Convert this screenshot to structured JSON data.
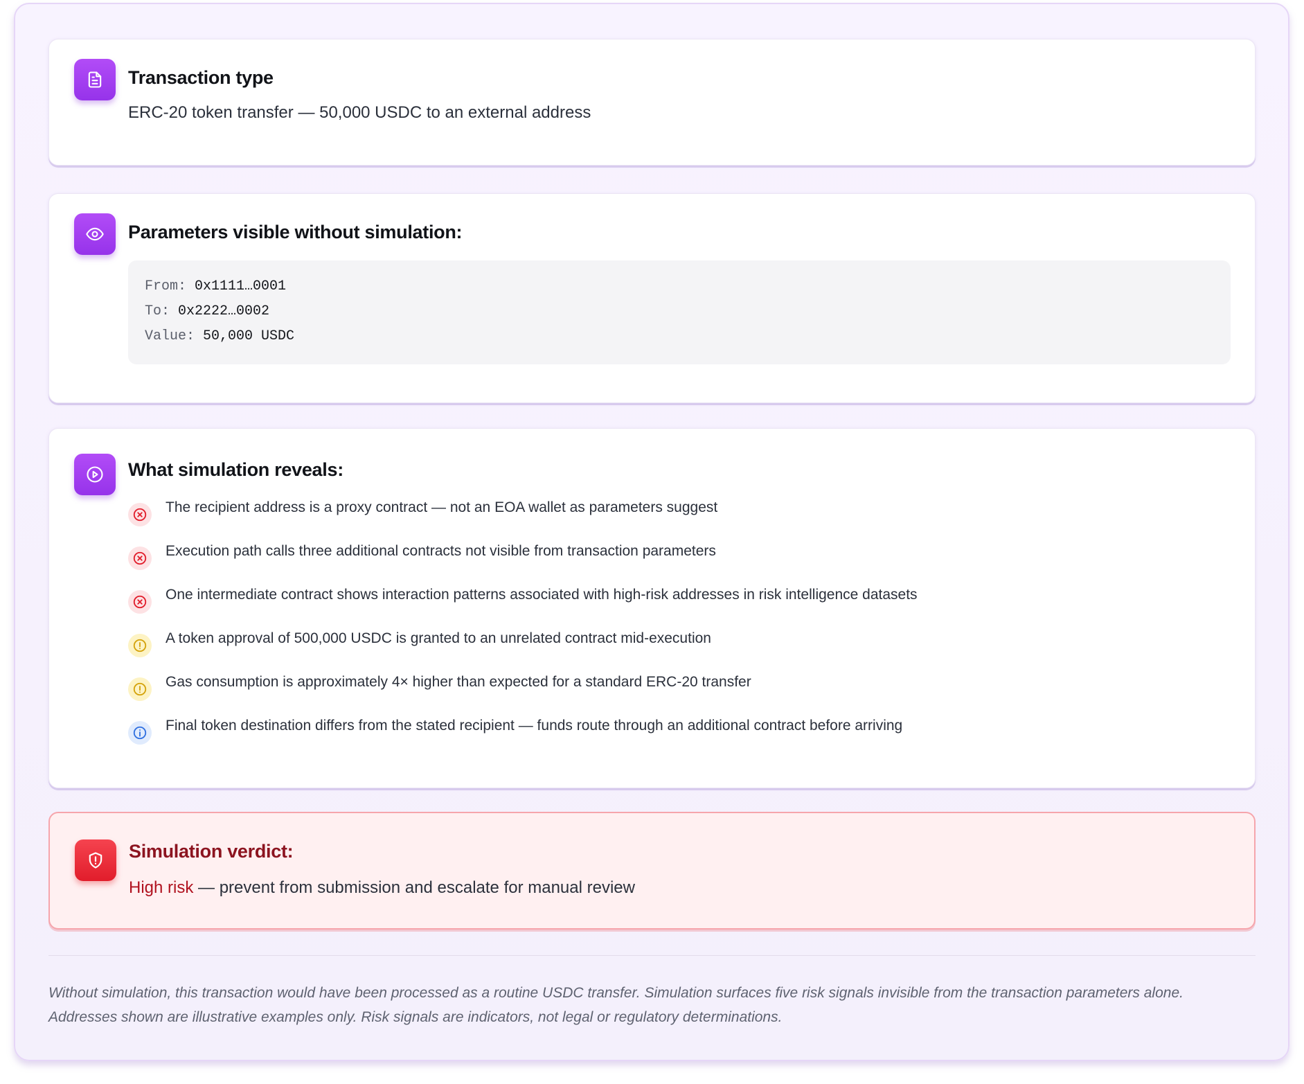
{
  "transaction_type": {
    "title": "Transaction type",
    "description": "ERC-20 token transfer — 50,000 USDC to an external address",
    "icon": "document-icon"
  },
  "parameters": {
    "title": "Parameters visible without simulation:",
    "icon": "eye-icon",
    "rows": [
      {
        "key": "From:",
        "value": "0x1111…0001"
      },
      {
        "key": "To:",
        "value": "0x2222…0002"
      },
      {
        "key": "Value:",
        "value": "50,000 USDC"
      }
    ]
  },
  "simulation": {
    "title": "What simulation reveals:",
    "icon": "play-circle-icon",
    "signals": [
      {
        "level": "risk",
        "icon": "x-circle-icon",
        "text": "The recipient address is a proxy contract — not an EOA wallet as parameters suggest"
      },
      {
        "level": "risk",
        "icon": "x-circle-icon",
        "text": "Execution path calls three additional contracts not visible from transaction parameters"
      },
      {
        "level": "risk",
        "icon": "x-circle-icon",
        "text": "One intermediate contract shows interaction patterns associated with high-risk addresses in risk intelligence datasets"
      },
      {
        "level": "warn",
        "icon": "alert-circle-icon",
        "text": "A token approval of 500,000 USDC is granted to an unrelated contract mid-execution"
      },
      {
        "level": "warn",
        "icon": "alert-circle-icon",
        "text": "Gas consumption is approximately 4× higher than expected for a standard ERC-20 transfer"
      },
      {
        "level": "info",
        "icon": "info-circle-icon",
        "text": "Final token destination differs from the stated recipient — funds route through an additional contract before arriving"
      }
    ]
  },
  "verdict": {
    "title": "Simulation verdict:",
    "icon": "shield-alert-icon",
    "emphasis": "High risk",
    "text": " — prevent from submission and escalate for manual review"
  },
  "footnote": {
    "line1": "Without simulation, this transaction would have been processed as a routine USDC transfer. Simulation surfaces five risk signals invisible from the transaction parameters alone.",
    "line2": "Addresses shown are illustrative examples only. Risk signals are indicators, not legal or regulatory determinations."
  },
  "colors": {
    "accent_purple": "#9d3cf0",
    "risk_red": "#e11d2b",
    "warn_yellow": "#d4a20a",
    "info_blue": "#2f6fe0",
    "verdict_bg": "#fff0f1"
  }
}
